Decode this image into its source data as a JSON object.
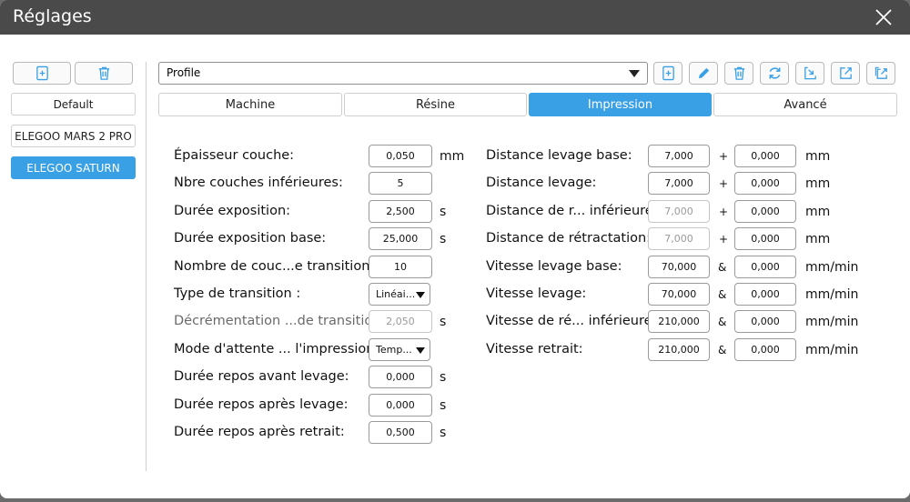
{
  "window": {
    "title": "Réglages"
  },
  "sidebar": {
    "profiles": [
      {
        "label": "Default"
      },
      {
        "label": "ELEGOO MARS 2 PRO"
      },
      {
        "label": "ELEGOO SATURN",
        "selected": true
      }
    ],
    "icons": [
      "add-icon",
      "trash-icon"
    ]
  },
  "toolbar": {
    "profile_select": "Profile",
    "icons": [
      "add-icon",
      "pencil-icon",
      "trash-icon",
      "refresh-icon",
      "import-icon",
      "export-icon",
      "export-all-icon"
    ]
  },
  "tabs": [
    {
      "label": "Machine"
    },
    {
      "label": "Résine"
    },
    {
      "label": "Impression",
      "active": true
    },
    {
      "label": "Avancé"
    }
  ],
  "left_params": [
    {
      "label": "Épaisseur couche:",
      "value": "0,050",
      "unit": "mm"
    },
    {
      "label": "Nbre couches inférieures:",
      "value": "5",
      "unit": ""
    },
    {
      "label": "Durée exposition:",
      "value": "2,500",
      "unit": "s"
    },
    {
      "label": "Durée exposition base:",
      "value": "25,000",
      "unit": "s"
    },
    {
      "label": "Nombre de couc...e transition :",
      "value": "10",
      "unit": ""
    },
    {
      "label": "Type de transition :",
      "value": "Linéai...",
      "unit": "",
      "dropdown": true
    },
    {
      "label": "Décrémentation ...de transition :",
      "value": "2,050",
      "unit": "s",
      "disabled": true
    },
    {
      "label": "Mode d'attente ... l'impression :",
      "value": "Temp...",
      "unit": "",
      "dropdown": true
    },
    {
      "label": "Durée repos avant levage:",
      "value": "0,000",
      "unit": "s"
    },
    {
      "label": "Durée repos après levage:",
      "value": "0,000",
      "unit": "s"
    },
    {
      "label": "Durée repos après retrait:",
      "value": "0,500",
      "unit": "s"
    }
  ],
  "right_params": [
    {
      "label": "Distance levage base:",
      "value": "7,000",
      "op": "+",
      "value2": "0,000",
      "unit": "mm"
    },
    {
      "label": "Distance levage:",
      "value": "7,000",
      "op": "+",
      "value2": "0,000",
      "unit": "mm"
    },
    {
      "label": "Distance de r... inférieure :",
      "value": "7,000",
      "op": "+",
      "value2": "0,000",
      "unit": "mm",
      "disabled": true
    },
    {
      "label": "Distance de rétractation:",
      "value": "7,000",
      "op": "+",
      "value2": "0,000",
      "unit": "mm",
      "disabled": true
    },
    {
      "label": "Vitesse levage base:",
      "value": "70,000",
      "op": "&",
      "value2": "0,000",
      "unit": "mm/min"
    },
    {
      "label": "Vitesse levage:",
      "value": "70,000",
      "op": "&",
      "value2": "0,000",
      "unit": "mm/min"
    },
    {
      "label": "Vitesse de ré... inférieure :",
      "value": "210,000",
      "op": "&",
      "value2": "0,000",
      "unit": "mm/min"
    },
    {
      "label": "Vitesse retrait:",
      "value": "210,000",
      "op": "&",
      "value2": "0,000",
      "unit": "mm/min"
    }
  ],
  "colors": {
    "accent": "#3aa0e6",
    "titlebar": "#4a4a4a"
  }
}
